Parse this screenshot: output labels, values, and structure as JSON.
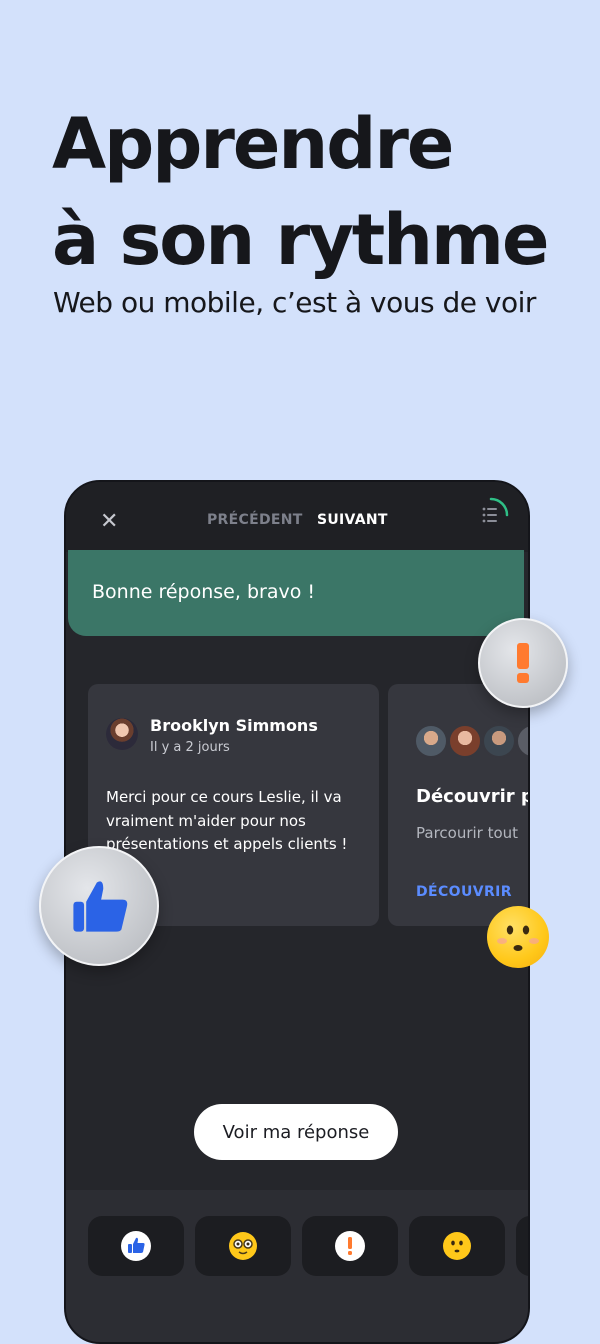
{
  "hero": {
    "title_line1": "Apprendre",
    "title_line2": "à son rythme",
    "subtitle": "Web ou mobile, c’est à vous de voir"
  },
  "phone": {
    "topbar": {
      "close_icon": "close-icon",
      "prev_label": "PRÉCÉDENT",
      "next_label": "SUIVANT",
      "lesson_list_icon": "list-progress-icon"
    },
    "feedback_banner": "Bonne réponse, bravo !",
    "comment_card": {
      "author": "Brooklyn Simmons",
      "time": "Il y a 2 jours",
      "text": "Merci pour ce cours Leslie, il va vraiment m'aider pour nos présentations et appels clients !"
    },
    "discover_card": {
      "title": "Découvrir p",
      "text": "Parcourir tout",
      "link": "DÉCOUVRIR"
    },
    "cta_label": "Voir ma réponse",
    "reactions": [
      "thumbs-up-icon",
      "nerd-face-icon",
      "exclamation-icon",
      "surprised-face-icon"
    ]
  },
  "colors": {
    "background": "#d3e1fb",
    "banner": "#3b7667",
    "phone": "#25262b",
    "link": "#5b8cff",
    "accent_orange": "#ff7a2f",
    "thumb_blue": "#2b63e6"
  }
}
